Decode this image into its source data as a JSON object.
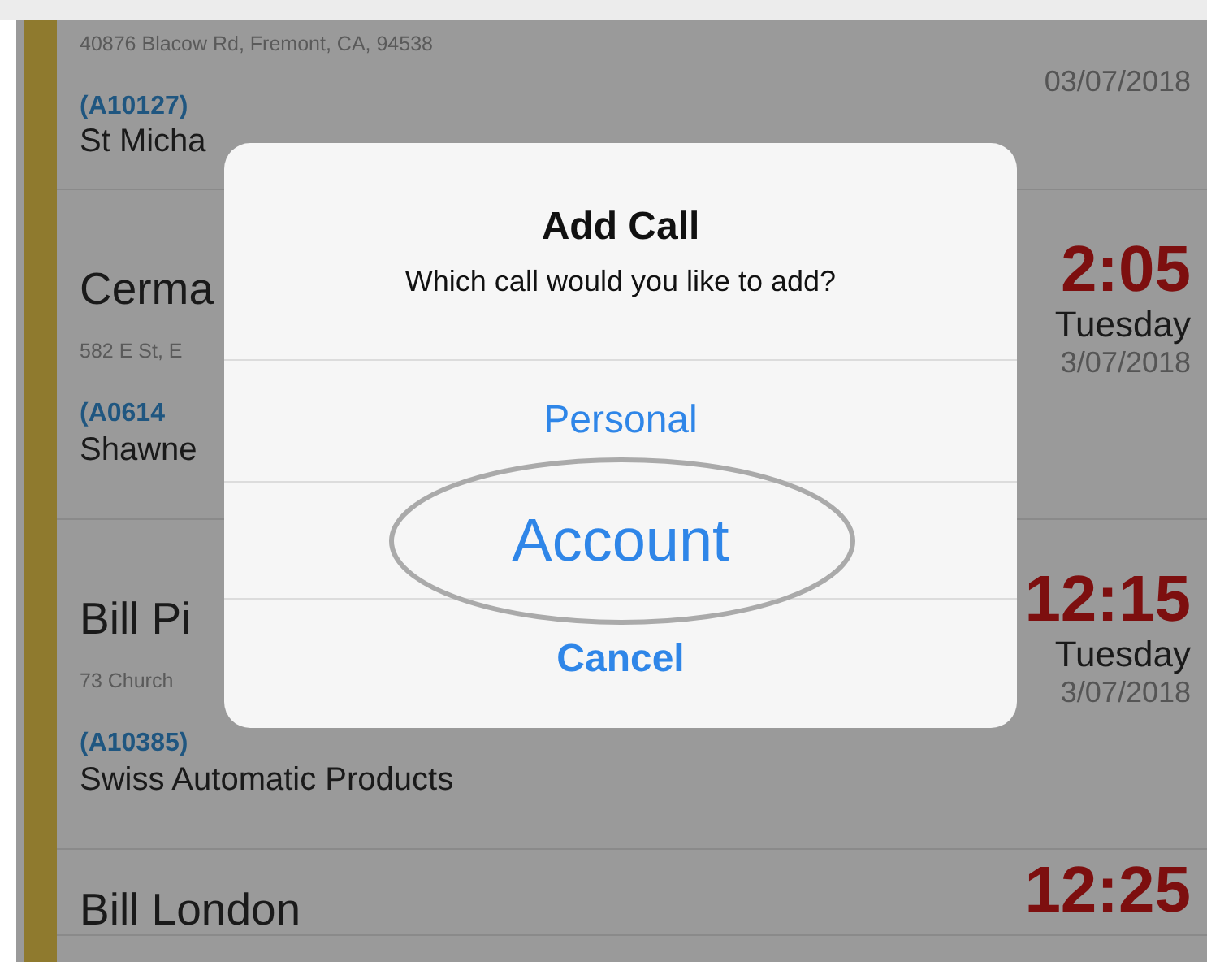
{
  "calls": [
    {
      "address": "40876 Blacow Rd, Fremont, CA, 94538",
      "account_id": "(A10127)",
      "company": "St Micha",
      "date": "03/07/2018"
    },
    {
      "name": "Cerma",
      "address": "582 E St, E",
      "account_id": "(A0614",
      "company": "Shawne",
      "time": "2:05",
      "day": "Tuesday",
      "date": "3/07/2018"
    },
    {
      "name": "Bill Pi",
      "address": "73 Church",
      "account_id": "(A10385)",
      "company": "Swiss Automatic Products",
      "time": "12:15",
      "day": "Tuesday",
      "date": "3/07/2018"
    },
    {
      "name": "Bill London",
      "time": "12:25"
    }
  ],
  "alert": {
    "title": "Add Call",
    "message": "Which call would you like to add?",
    "actions": [
      {
        "label": "Personal",
        "kind": "default",
        "highlighted": false
      },
      {
        "label": "Account",
        "kind": "default",
        "highlighted": true
      },
      {
        "label": "Cancel",
        "kind": "cancel",
        "highlighted": false
      }
    ]
  }
}
